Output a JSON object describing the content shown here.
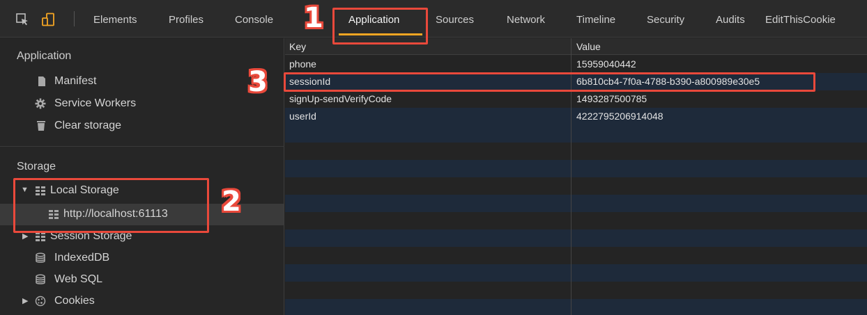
{
  "toolbar": {
    "icons": [
      "inspect-icon",
      "device-mode-icon"
    ],
    "tabs": [
      {
        "label": "Elements"
      },
      {
        "label": "Profiles"
      },
      {
        "label": "Console"
      },
      {
        "label": "Application",
        "active": true
      },
      {
        "label": "Sources"
      },
      {
        "label": "Network"
      },
      {
        "label": "Timeline"
      },
      {
        "label": "Security"
      },
      {
        "label": "Audits"
      },
      {
        "label": "EditThisCookie"
      }
    ],
    "active_tab_color": "#f5a623"
  },
  "sidebar": {
    "application": {
      "title": "Application",
      "items": [
        {
          "label": "Manifest",
          "icon": "file-icon"
        },
        {
          "label": "Service Workers",
          "icon": "gear-icon"
        },
        {
          "label": "Clear storage",
          "icon": "trash-icon"
        }
      ]
    },
    "storage": {
      "title": "Storage",
      "items": [
        {
          "label": "Local Storage",
          "icon": "grid-icon",
          "expanded": true
        },
        {
          "label": "http://localhost:61113",
          "icon": "grid-icon",
          "selected": true
        },
        {
          "label": "Session Storage",
          "icon": "grid-icon",
          "expanded": false
        },
        {
          "label": "IndexedDB",
          "icon": "database-icon"
        },
        {
          "label": "Web SQL",
          "icon": "database-icon"
        },
        {
          "label": "Cookies",
          "icon": "cookie-icon",
          "expanded": false
        }
      ]
    }
  },
  "table": {
    "columns": [
      "Key",
      "Value"
    ],
    "rows": [
      {
        "key": "phone",
        "value": "15959040442"
      },
      {
        "key": "sessionId",
        "value": "6b810cb4-7f0a-4788-b390-a800989e30e5"
      },
      {
        "key": "signUp-sendVerifyCode",
        "value": "1493287500785"
      },
      {
        "key": "userId",
        "value": "4222795206914048"
      }
    ]
  },
  "annotations": {
    "color": "#e9493b",
    "labels": [
      "1",
      "2",
      "3"
    ]
  }
}
